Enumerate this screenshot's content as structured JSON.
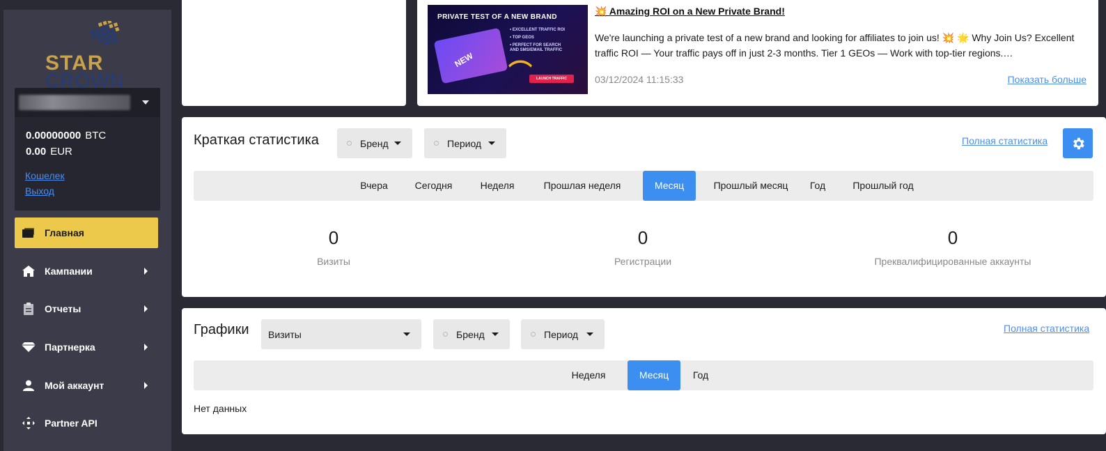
{
  "brand": {
    "logo_top": "STAR",
    "logo_bottom": "CROWN",
    "gold": "#c9a24a",
    "navy": "#243c78"
  },
  "account": {
    "btc_amount": "0.00000000",
    "btc_currency": "BTC",
    "eur_amount": "0.00",
    "eur_currency": "EUR",
    "wallet_link": "Кошелек",
    "logout_link": "Выход"
  },
  "nav": {
    "items": [
      {
        "label": "Главная",
        "icon": "wallet-icon",
        "active": true
      },
      {
        "label": "Кампании",
        "icon": "home-icon"
      },
      {
        "label": "Отчеты",
        "icon": "clipboard-icon"
      },
      {
        "label": "Партнерка",
        "icon": "diamond-icon"
      },
      {
        "label": "Мой аккаунт",
        "icon": "user-icon"
      },
      {
        "label": "Partner API",
        "icon": "api-icon"
      }
    ]
  },
  "news": {
    "image_headline": "PRIVATE TEST OF A NEW BRAND",
    "image_bullets": [
      "• EXCELLENT TRAFFIC ROI",
      "• TOP GEOS",
      "• PERFECT FOR SEARCH",
      "  AND SMS/EMAIL TRAFFIC"
    ],
    "image_tag": "NEW",
    "image_button": "LAUNCH TRAFFIC",
    "title": "💥 Amazing ROI on a New Private Brand!",
    "text": "We're launching a private test of a new brand and looking for affiliates to join us! 💥   🌟 Why Join Us?  Excellent traffic ROI — Your traffic pays off in just 2-3 months.   Tier 1 GEOs — Work with top-tier regions.…",
    "date": "03/12/2024 11:15:33",
    "more_link": "Показать больше"
  },
  "quick_stats": {
    "title": "Краткая статистика",
    "brand_filter": "Бренд",
    "period_filter": "Период",
    "full_link": "Полная статистика",
    "tabs": [
      "Вчера",
      "Сегодня",
      "Неделя",
      "Прошлая неделя",
      "Месяц",
      "Прошлый месяц",
      "Год",
      "Прошлый год"
    ],
    "active_tab": "Месяц",
    "metrics": [
      {
        "value": "0",
        "label": "Визиты"
      },
      {
        "value": "0",
        "label": "Регистрации"
      },
      {
        "value": "0",
        "label": "Преквалифицированные аккаунты"
      }
    ]
  },
  "charts": {
    "title": "Графики",
    "metric_select": "Визиты",
    "brand_filter": "Бренд",
    "period_filter": "Период",
    "full_link": "Полная статистика",
    "tabs": [
      "Неделя",
      "Месяц",
      "Год"
    ],
    "active_tab": "Месяц",
    "empty_text": "Нет данных"
  },
  "colors": {
    "accent_blue": "#3d8ef1",
    "active_nav": "#ecc94b",
    "sidebar": "#3b3b49",
    "page_bg": "#2a2a35"
  }
}
